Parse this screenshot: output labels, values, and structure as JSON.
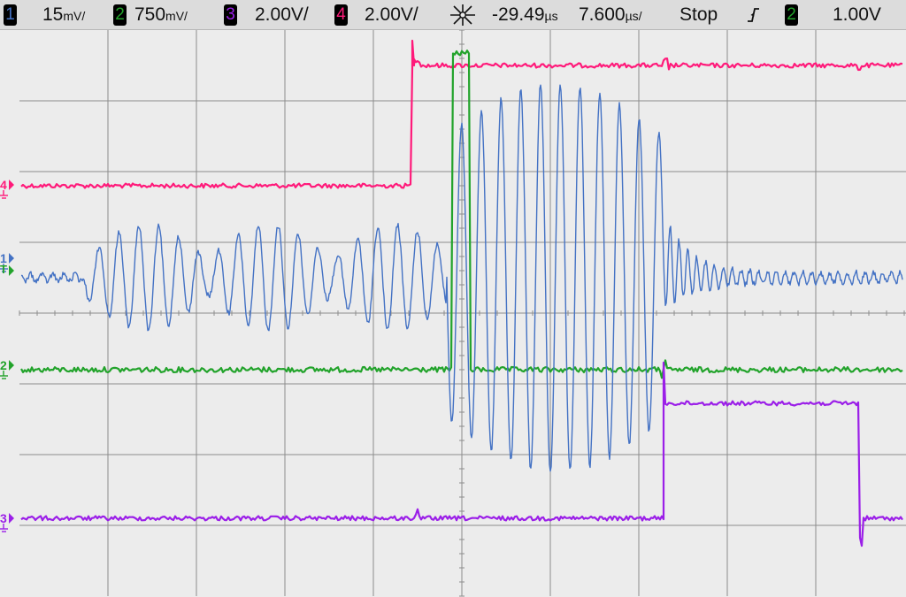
{
  "status_bar": {
    "ch1": {
      "number": "1",
      "scale": "15",
      "unit": "mV/",
      "color": "#4472c4"
    },
    "ch2": {
      "number": "2",
      "scale": "750",
      "unit": "mV/",
      "color": "#22a32b"
    },
    "ch3": {
      "number": "3",
      "scale": "2.00V/",
      "color": "#9b1fe8"
    },
    "ch4": {
      "number": "4",
      "scale": "2.00V/",
      "color": "#ff1a7a"
    },
    "trigger_icon": "trigger-position-icon",
    "time_offset": "-29.49",
    "time_offset_unit": "µs",
    "time_scale": "7.600",
    "time_scale_unit": "µs/",
    "run_state": "Stop",
    "edge_icon": "rising-edge-icon",
    "trigger_source": "2",
    "trigger_level": "1.00V"
  },
  "markers": {
    "ch1": "1",
    "ch2": "2",
    "ch3": "3",
    "ch4": "4",
    "trigger_level": "T"
  },
  "colors": {
    "background": "#ececec",
    "grid": "#8c8c8c",
    "ch1": "#4472c4",
    "ch2": "#22a32b",
    "ch3": "#9b1fe8",
    "ch4": "#ff1a7a"
  }
}
